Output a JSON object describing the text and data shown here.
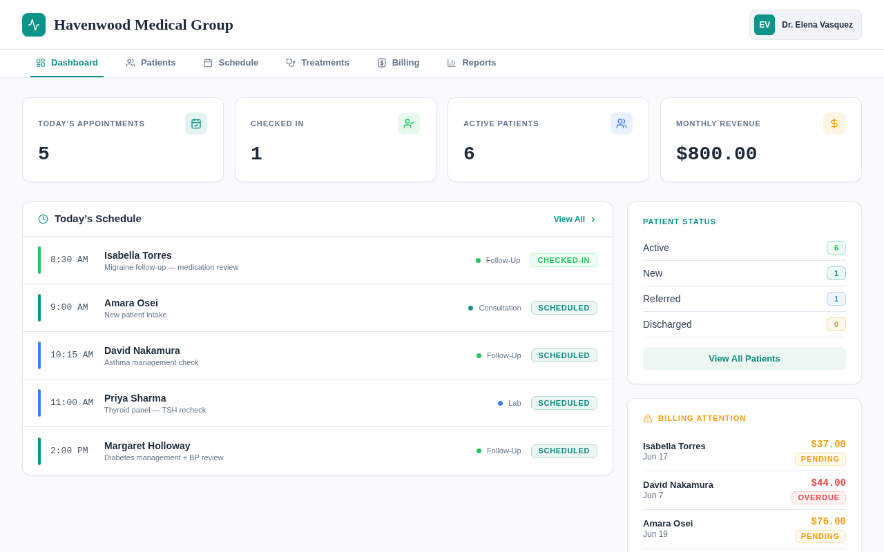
{
  "header": {
    "title": "Havenwood Medical Group",
    "user": {
      "initials": "EV",
      "name": "Dr. Elena Vasquez"
    }
  },
  "tabs": [
    {
      "label": "Dashboard",
      "selected": true
    },
    {
      "label": "Patients",
      "selected": false
    },
    {
      "label": "Schedule",
      "selected": false
    },
    {
      "label": "Treatments",
      "selected": false
    },
    {
      "label": "Billing",
      "selected": false
    },
    {
      "label": "Reports",
      "selected": false
    }
  ],
  "stats": [
    {
      "label": "TODAY'S APPOINTMENTS",
      "value": "5",
      "color": "#0d9488"
    },
    {
      "label": "CHECKED IN",
      "value": "1",
      "color": "#22c55e"
    },
    {
      "label": "ACTIVE PATIENTS",
      "value": "6",
      "color": "#3b82f6"
    },
    {
      "label": "MONTHLY REVENUE",
      "value": "$800.00",
      "color": "#f59e0b"
    }
  ],
  "schedule": {
    "title": "Today’s Schedule",
    "link": "View All",
    "appointments": [
      {
        "time": "8:30 AM",
        "name": "Isabella Torres",
        "detail": "Migraine follow-up — medication review",
        "color": "#22c55e",
        "type": {
          "label": "Follow-Up",
          "color": "#22c55e"
        },
        "status": {
          "label": "CHECKED-IN",
          "kind": "checked_in"
        }
      },
      {
        "time": "9:00 AM",
        "name": "Amara Osei",
        "detail": "New patient intake",
        "color": "#0d9488",
        "type": {
          "label": "Consultation",
          "color": "#0d9488"
        },
        "status": {
          "label": "SCHEDULED",
          "kind": "scheduled"
        }
      },
      {
        "time": "10:15 AM",
        "name": "David Nakamura",
        "detail": "Asthma management check",
        "color": "#3b82f6",
        "type": {
          "label": "Follow-Up",
          "color": "#22c55e"
        },
        "status": {
          "label": "SCHEDULED",
          "kind": "scheduled"
        }
      },
      {
        "time": "11:00 AM",
        "name": "Priya Sharma",
        "detail": "Thyroid panel — TSH recheck",
        "color": "#3b82f6",
        "type": {
          "label": "Lab",
          "color": "#3b82f6"
        },
        "status": {
          "label": "SCHEDULED",
          "kind": "scheduled"
        }
      },
      {
        "time": "2:00 PM",
        "name": "Margaret Holloway",
        "detail": "Diabetes management + BP review",
        "color": "#0d9488",
        "type": {
          "label": "Follow-Up",
          "color": "#22c55e"
        },
        "status": {
          "label": "SCHEDULED",
          "kind": "scheduled"
        }
      }
    ]
  },
  "patient_status": {
    "title": "PATIENT STATUS",
    "items": [
      {
        "label": "Active",
        "count": "6",
        "color": "#22c55e"
      },
      {
        "label": "New",
        "count": "1",
        "color": "#0d9488"
      },
      {
        "label": "Referred",
        "count": "1",
        "color": "#3b82f6"
      },
      {
        "label": "Discharged",
        "count": "0",
        "color": "#f59e0b"
      }
    ],
    "button": "View All Patients"
  },
  "billing": {
    "title": "BILLING ATTENTION",
    "items": [
      {
        "name": "Isabella Torres",
        "date": "Jun 17",
        "amount": "$37.00",
        "status": {
          "label": "PENDING",
          "kind": "pending"
        }
      },
      {
        "name": "David Nakamura",
        "date": "Jun 7",
        "amount": "$44.00",
        "status": {
          "label": "OVERDUE",
          "kind": "overdue"
        }
      },
      {
        "name": "Amara Osei",
        "date": "Jun 19",
        "amount": "$76.00",
        "status": {
          "label": "PENDING",
          "kind": "pending"
        }
      }
    ]
  }
}
